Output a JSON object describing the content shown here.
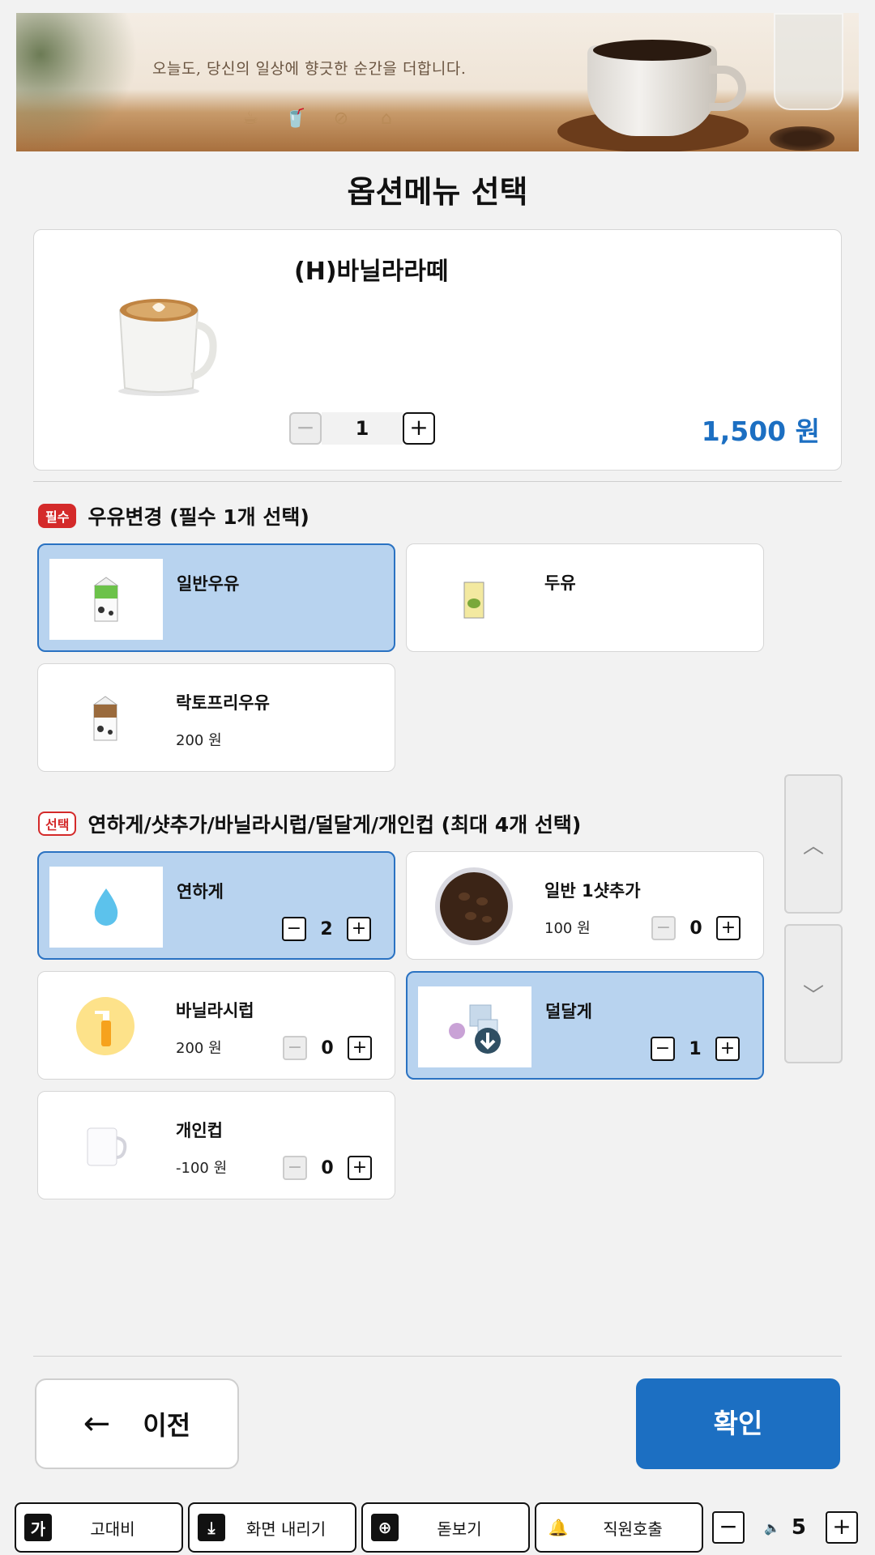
{
  "banner": {
    "tagline": "오늘도, 당신의 일상에 향긋한 순간을 더합니다.",
    "icons": [
      "coffee-cup-icon",
      "takeout-cup-icon",
      "coffee-bean-icon",
      "cake-icon"
    ]
  },
  "page_title": "옵션메뉴 선택",
  "product": {
    "name": "(H)바닐라라떼",
    "quantity": "1",
    "price": "1,500 원",
    "minus": "−",
    "plus": "+"
  },
  "section_required": {
    "badge": "필수",
    "title": "우유변경  (필수 1개 선택)",
    "options": [
      {
        "name": "일반우유",
        "price": "",
        "selected": true
      },
      {
        "name": "두유",
        "price": "",
        "selected": false
      },
      {
        "name": "락토프리우유",
        "price": "200 원",
        "selected": false
      }
    ]
  },
  "section_optional": {
    "badge": "선택",
    "title": "연하게/샷추가/바닐라시럽/덜달게/개인컵  (최대 4개 선택)",
    "options": [
      {
        "name": "연하게",
        "price": "",
        "qty": "2",
        "selected": true
      },
      {
        "name": "일반 1샷추가",
        "price": "100 원",
        "qty": "0",
        "selected": false
      },
      {
        "name": "바닐라시럽",
        "price": "200 원",
        "qty": "0",
        "selected": false
      },
      {
        "name": "덜달게",
        "price": "",
        "qty": "1",
        "selected": true
      },
      {
        "name": "개인컵",
        "price": "-100 원",
        "qty": "0",
        "selected": false
      }
    ]
  },
  "scroll": {
    "up": "︿",
    "down": "﹀"
  },
  "footer": {
    "prev_arrow": "←",
    "prev_label": "이전",
    "confirm_label": "확인"
  },
  "toolbar": {
    "high_contrast": {
      "icon": "가",
      "label": "고대비"
    },
    "screen_down": {
      "icon": "⤓",
      "label": "화면 내리기"
    },
    "magnifier": {
      "icon": "⊕",
      "label": "돋보기"
    },
    "staff_call": {
      "icon": "🔔",
      "label": "직원호출"
    },
    "volume": {
      "value": "5",
      "minus": "−",
      "plus": "+",
      "icon": "🔈"
    }
  }
}
